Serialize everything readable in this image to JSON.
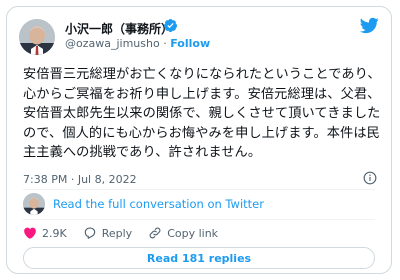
{
  "author": {
    "name": "小沢一郎（事務所）",
    "handle": "@ozawa_jimusho",
    "separator": "·",
    "follow_label": "Follow"
  },
  "tweet": {
    "text": "安倍晋三元総理がお亡くなりになられたということであり、心からご冥福をお祈り申し上げます。安倍元総理は、父君、安倍晋太郎先生以来の関係で、親しくさせて頂いてきましたので、個人的にも心からお悔やみを申し上げます。本件は民主主義への挑戦であり、許されません。",
    "time": "7:38 PM",
    "date": "Jul 8, 2022",
    "meta_separator": "·"
  },
  "conversation": {
    "link_label": "Read the full conversation on Twitter"
  },
  "actions": {
    "likes": "2.9K",
    "reply_label": "Reply",
    "copy_label": "Copy link"
  },
  "replies_button": {
    "label": "Read 181 replies"
  },
  "colors": {
    "accent": "#1d9bf0",
    "like": "#f91880",
    "text": "#0f1419",
    "muted": "#536471",
    "border": "#cfd9de"
  },
  "icons": [
    "avatar",
    "verified-badge-icon",
    "twitter-bird-icon",
    "info-icon",
    "heart-icon",
    "reply-icon",
    "link-icon"
  ]
}
